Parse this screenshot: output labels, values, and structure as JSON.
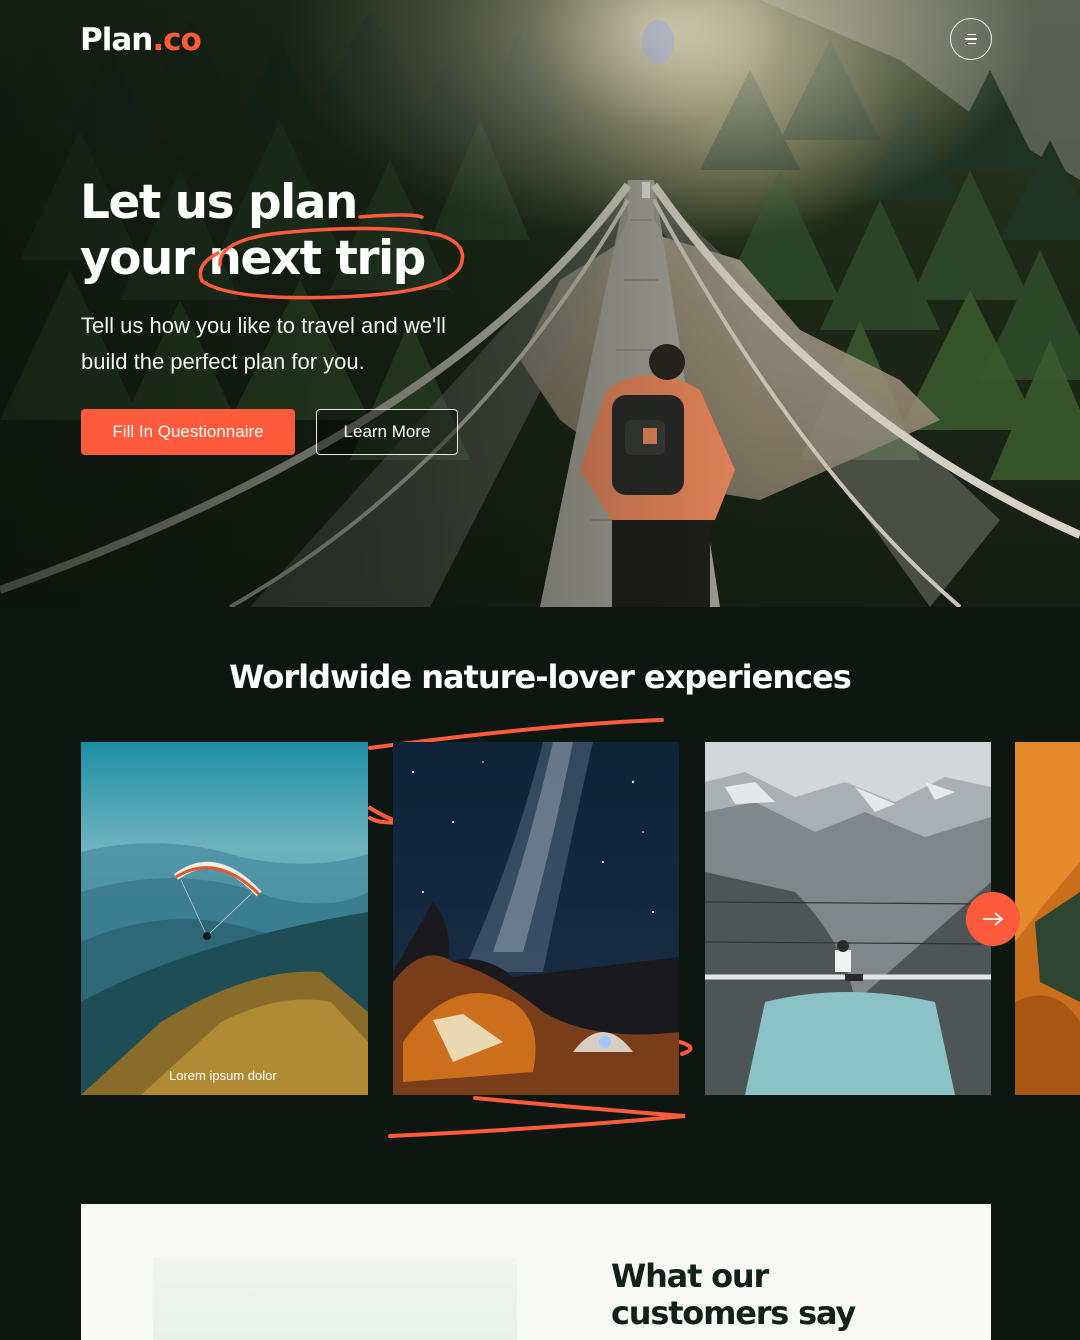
{
  "brand": {
    "logo_main": "Plan",
    "logo_suffix": ".co",
    "accent": "#ff5a3c"
  },
  "nav": {
    "menu_icon": "hamburger-menu-icon"
  },
  "hero": {
    "title_line1": "Let us plan",
    "title_line2": "your next trip",
    "subtitle": "Tell us how you like to travel and we'll build the perfect plan for you.",
    "primary_button": "Fill In Questionnaire",
    "secondary_button": "Learn More"
  },
  "experiences": {
    "heading": "Worldwide nature-lover experiences",
    "cards": [
      {
        "caption": "Lorem ipsum dolor",
        "image": "paragliding-mountains"
      },
      {
        "caption": "",
        "image": "milky-way-camping"
      },
      {
        "caption": "",
        "image": "suspension-bridge-lake"
      },
      {
        "caption": "",
        "image": "tent-interior"
      }
    ],
    "next_icon": "arrow-right-icon"
  },
  "testimonials": {
    "heading_line1": "What our",
    "heading_line2": "customers say"
  }
}
